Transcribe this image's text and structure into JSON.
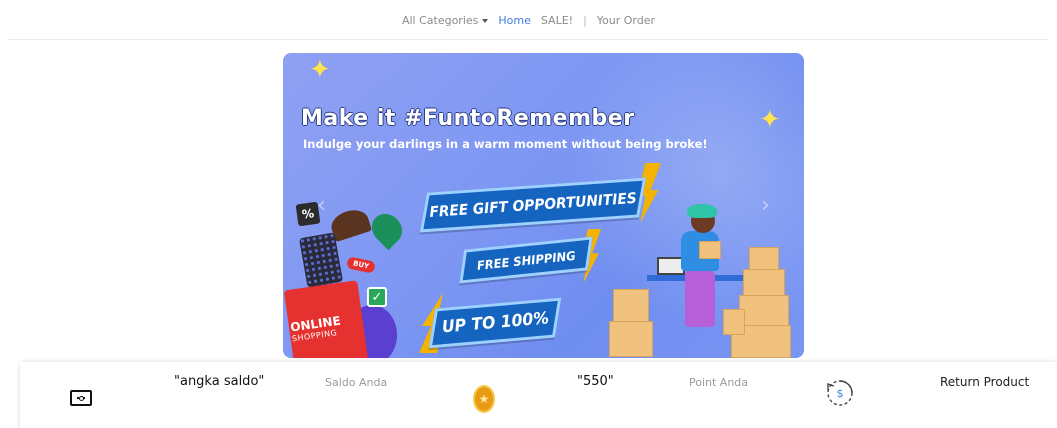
{
  "nav": {
    "categories_label": "All Categories",
    "home_label": "Home",
    "sale_label": "SALE!",
    "separator": "|",
    "order_label": "Your Order"
  },
  "banner": {
    "title": "Make it #FuntoRemember",
    "subtitle": "Indulge your darlings in a warm moment without being broke!",
    "tag_gift": "FREE GIFT OPPORTUNITIES",
    "tag_shipping": "FREE SHIPPING",
    "tag_percent": "UP TO 100%",
    "bag_text": "ONLINE",
    "bag_subtext": "SHOPPING",
    "buy_text": "BUY",
    "percent_icon": "%",
    "check_icon": "✓",
    "prev_arrow": "‹",
    "next_arrow": "›"
  },
  "info": {
    "balance_value": "\"angka saldo\"",
    "balance_label": "Saldo Anda",
    "points_value": "\"550\"",
    "points_label": "Point Anda",
    "return_label": "Return Product",
    "coin_symbol": "★",
    "dollar_symbol": "$"
  },
  "colors": {
    "nav_active": "#3f7fe0",
    "banner_bg": "#7f98f3",
    "tag_bg": "#1565c0",
    "bolt": "#f5b301",
    "coin": "#e89b12",
    "return_icon": "#3f7fe0"
  },
  "icons": {
    "balance": "money-bill-icon",
    "points": "coin-icon",
    "return": "refund-icon",
    "categories_caret": "caret-down-icon"
  }
}
